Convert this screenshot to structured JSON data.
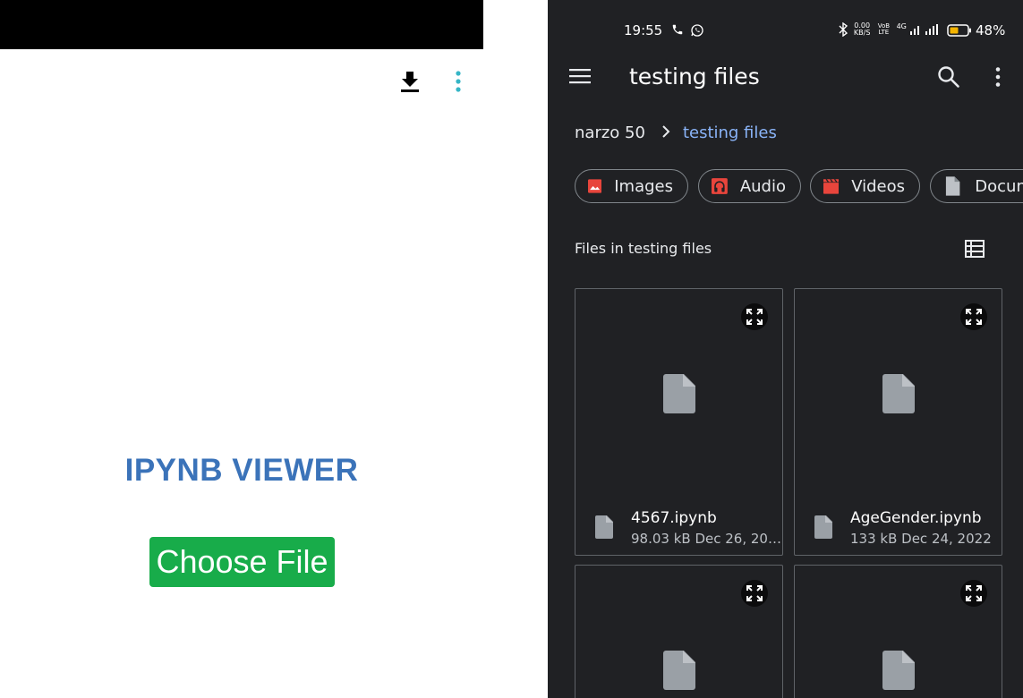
{
  "left_app": {
    "title": "IPYNB VIEWER",
    "choose_file_label": "Choose File",
    "title_color": "#3b73b9",
    "button_color": "#18ac4a",
    "icons": [
      "download-icon",
      "more-vert-icon"
    ]
  },
  "status_bar": {
    "time": "19:55",
    "net_speed": "0.00 KB/S",
    "volte": "VoB LTE",
    "network": "4G",
    "battery": "48%"
  },
  "app_bar": {
    "title": "testing files",
    "icons": [
      "menu-icon",
      "search-icon",
      "more-vert-icon"
    ]
  },
  "breadcrumb": {
    "items": [
      "narzo 50",
      "testing files"
    ]
  },
  "chips": [
    {
      "label": "Images",
      "icon": "image-icon",
      "color": "#e8453c"
    },
    {
      "label": "Audio",
      "icon": "headphones-icon",
      "color": "#e8453c"
    },
    {
      "label": "Videos",
      "icon": "clapperboard-icon",
      "color": "#e8453c"
    },
    {
      "label": "Docum",
      "icon": "document-icon",
      "color": "#bdc1c6"
    }
  ],
  "section": {
    "title": "Files in testing files"
  },
  "files": [
    {
      "name": "4567.ipynb",
      "meta": "98.03 kB Dec 26, 20…"
    },
    {
      "name": "AgeGender.ipynb",
      "meta": "133 kB Dec 24, 2022"
    },
    {
      "name": "",
      "meta": ""
    },
    {
      "name": "",
      "meta": ""
    }
  ],
  "colors": {
    "dark_bg": "#202124",
    "link": "#8ab4f8",
    "chip_border": "#80868b"
  }
}
